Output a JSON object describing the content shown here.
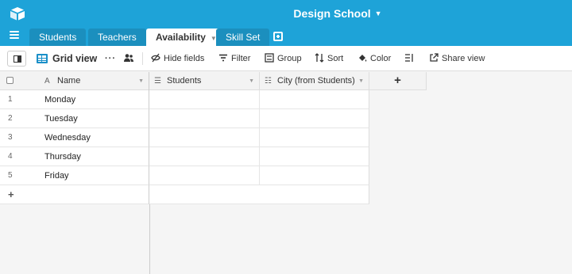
{
  "app": {
    "logo_icon": "airtable-logo-icon",
    "base_title": "Design School",
    "accent_color": "#1ea3d8"
  },
  "tabs": [
    {
      "label": "Students",
      "active": false
    },
    {
      "label": "Teachers",
      "active": false
    },
    {
      "label": "Availability",
      "active": true
    },
    {
      "label": "Skill Set",
      "active": false
    }
  ],
  "toolbar": {
    "view_name": "Grid view",
    "hide_fields": "Hide fields",
    "filter": "Filter",
    "group": "Group",
    "sort": "Sort",
    "color": "Color",
    "share_view": "Share view"
  },
  "grid": {
    "columns": [
      {
        "label": "Name",
        "icon": "text-field-icon"
      },
      {
        "label": "Students",
        "icon": "link-field-icon"
      },
      {
        "label": "City (from Students)",
        "icon": "lookup-field-icon"
      }
    ],
    "rows": [
      {
        "num": "1",
        "name": "Monday"
      },
      {
        "num": "2",
        "name": "Tuesday"
      },
      {
        "num": "3",
        "name": "Wednesday"
      },
      {
        "num": "4",
        "name": "Thursday"
      },
      {
        "num": "5",
        "name": "Friday"
      }
    ],
    "add_row": "+",
    "add_column": "+"
  }
}
